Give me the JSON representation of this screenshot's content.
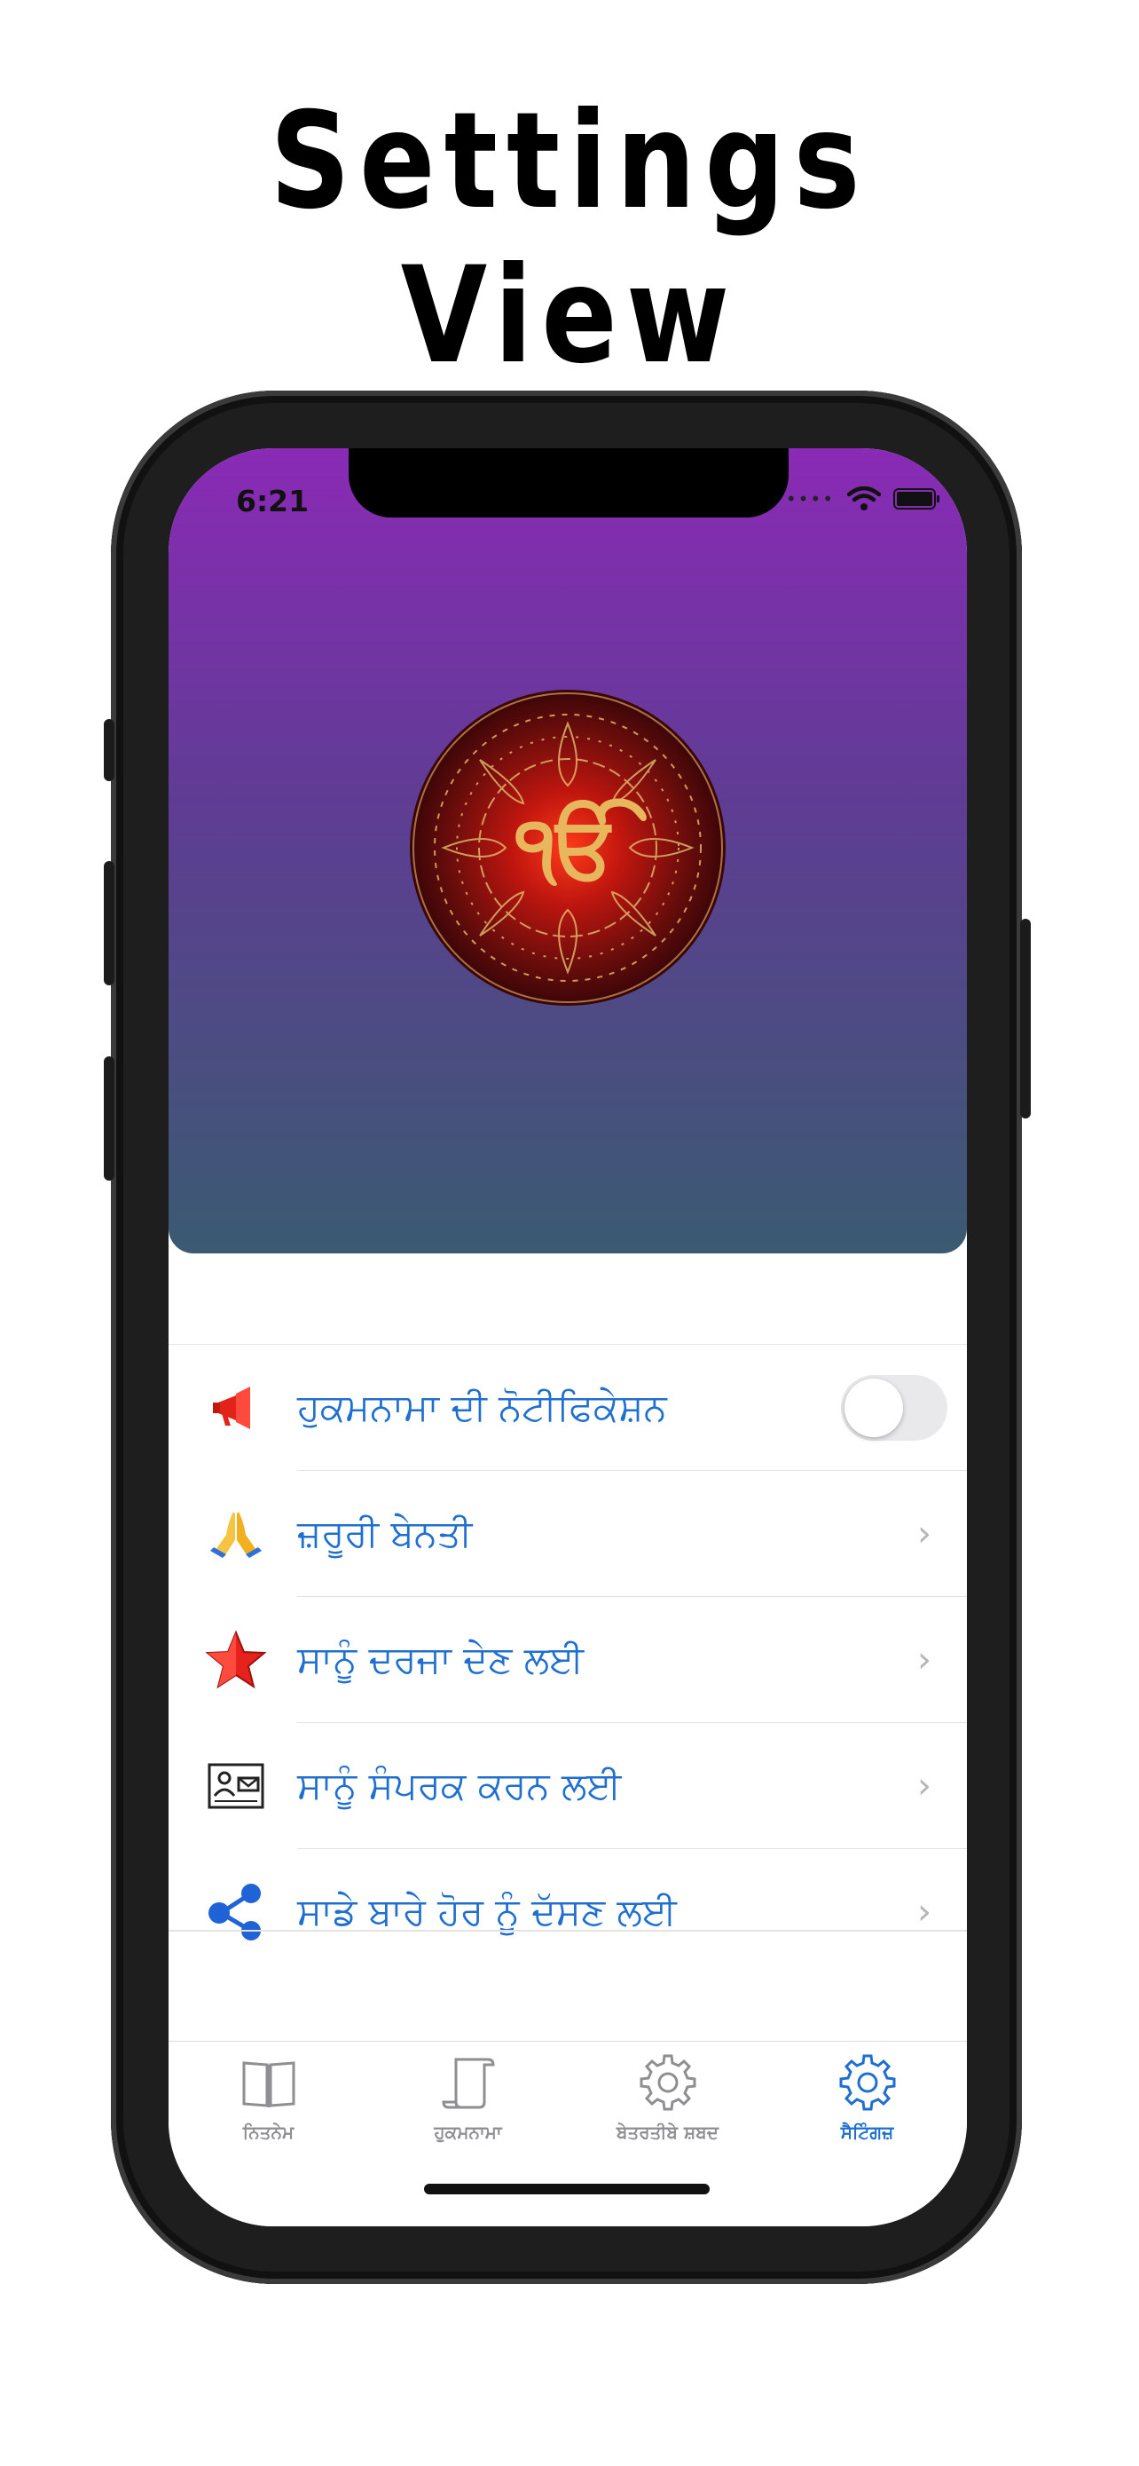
{
  "headline": "Settings View",
  "status_bar": {
    "time": "6:21"
  },
  "settings_list": [
    {
      "label": "ਹੁਕਮਨਾਮਾ ਦੀ ਨੋਟੀਫਿਕੇਸ਼ਨ",
      "icon": "megaphone-icon",
      "control": "toggle",
      "toggle_on": false
    },
    {
      "label": "ਜ਼ਰੂਰੀ ਬੇਨਤੀ",
      "icon": "folded-hands-icon",
      "control": "chevron"
    },
    {
      "label": "ਸਾਨੂੰ ਦਰਜਾ ਦੇਣ ਲਈ",
      "icon": "star-icon",
      "control": "chevron"
    },
    {
      "label": "ਸਾਨੂੰ ਸੰਪਰਕ ਕਰਨ ਲਈ",
      "icon": "contact-card-icon",
      "control": "chevron"
    },
    {
      "label": "ਸਾਡੇ ਬਾਰੇ ਹੋਰ ਨੂੰ ਦੱਸਣ ਲਈ",
      "icon": "share-icon",
      "control": "chevron"
    }
  ],
  "tabs": [
    {
      "label": "ਨਿਤਨੇਮ",
      "icon": "book-icon",
      "active": false
    },
    {
      "label": "ਹੁਕਮਨਾਮਾ",
      "icon": "scroll-icon",
      "active": false
    },
    {
      "label": "ਬੇਤਰਤੀਬੇ ਸ਼ਬਦ",
      "icon": "gear-icon",
      "active": false
    },
    {
      "label": "ਸੈਟਿੰਗਜ਼",
      "icon": "gear-icon",
      "active": true
    }
  ],
  "colors": {
    "accent": "#1f6fd1",
    "header_gradient_top": "#8a2ab6",
    "header_gradient_bottom": "#3b5a72",
    "inactive_tab": "#8e8e93"
  },
  "logo": {
    "symbol": "ੴ"
  }
}
